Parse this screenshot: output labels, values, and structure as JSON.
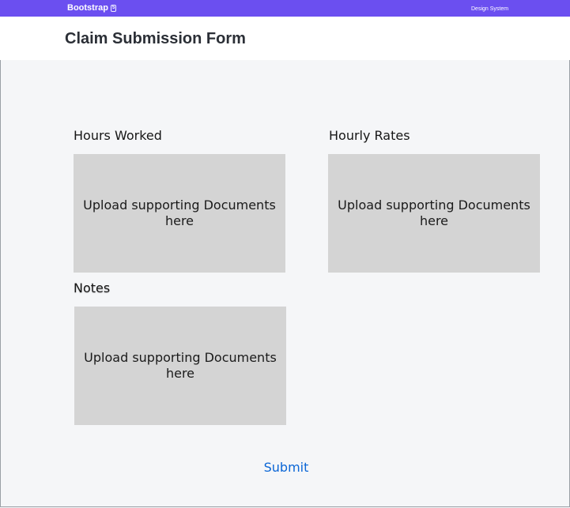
{
  "navbar": {
    "brand": "Bootstrap",
    "brand_badge": "5",
    "link": "Design System",
    "color": "#6b4ff0"
  },
  "header": {
    "title": "Claim Submission Form"
  },
  "sections": {
    "hours": {
      "label": "Hours Worked",
      "upload_text": "Upload supporting Documents here"
    },
    "rates": {
      "label": "Hourly Rates",
      "upload_text": "Upload supporting Documents here"
    },
    "notes": {
      "label": "Notes",
      "upload_text": "Upload supporting Documents here"
    }
  },
  "submit": {
    "label": "Submit",
    "color": "#0b66d6"
  }
}
